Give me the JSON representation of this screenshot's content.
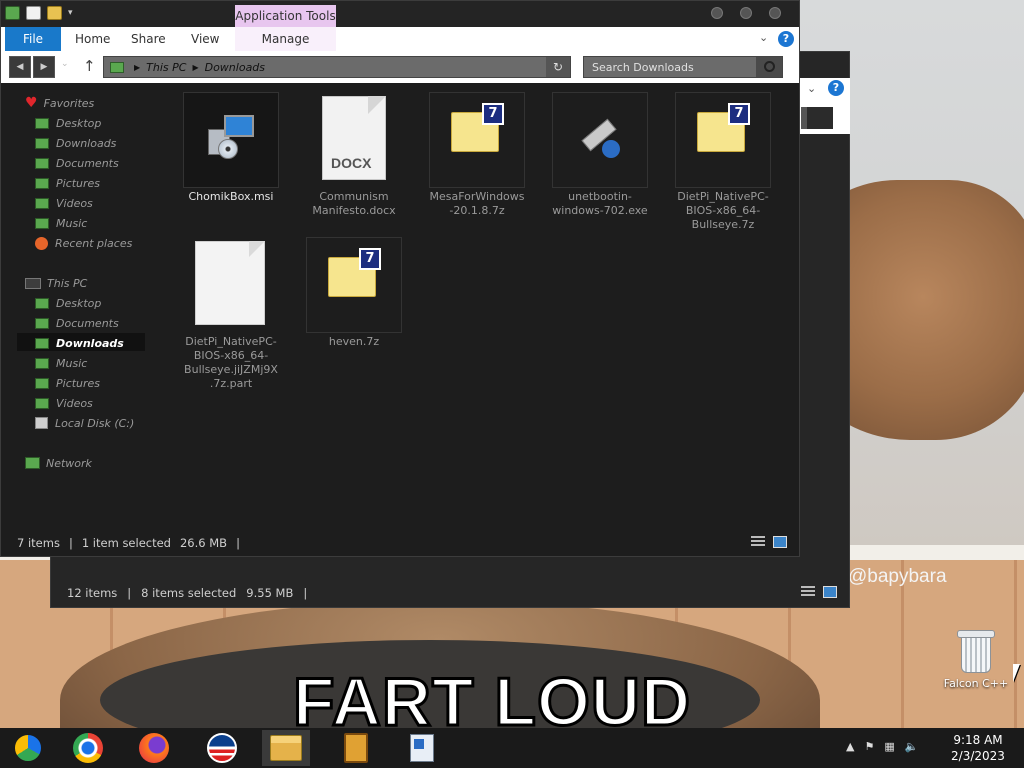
{
  "desktop": {
    "meme_text": "FART LOUD",
    "watermark": "@bapybara",
    "icon_label": "Falcon C++"
  },
  "back_window": {
    "status": {
      "count": "12 items",
      "selection": "8 items selected",
      "size": "9.55 MB"
    }
  },
  "window": {
    "context_tab": "Application Tools",
    "tabs": {
      "file": "File",
      "home": "Home",
      "share": "Share",
      "view": "View",
      "manage": "Manage"
    },
    "help_label": "?",
    "address": {
      "crumbs": [
        "This PC",
        "Downloads"
      ]
    },
    "search_placeholder": "Search Downloads",
    "navpane": {
      "favorites": "Favorites",
      "fav_items": [
        "Desktop",
        "Downloads",
        "Documents",
        "Pictures",
        "Videos",
        "Music",
        "Recent places"
      ],
      "this_pc": "This PC",
      "pc_items": [
        "Desktop",
        "Documents",
        "Downloads",
        "Music",
        "Pictures",
        "Videos",
        "Local Disk (C:)"
      ],
      "network": "Network",
      "selected": "Downloads"
    },
    "files": [
      {
        "name": "ChomikBox.msi",
        "icon": "installer-icon",
        "selected": true
      },
      {
        "name": "Communism Manifesto.docx",
        "icon": "docx-icon",
        "type_label": "DOCX"
      },
      {
        "name": "MesaForWindows-20.1.8.7z",
        "icon": "7z-archive-icon",
        "badge": "7"
      },
      {
        "name": "unetbootin-windows-702.exe",
        "icon": "usb-gear-icon"
      },
      {
        "name": "DietPi_NativePC-BIOS-x86_64-Bullseye.7z",
        "icon": "7z-archive-icon",
        "badge": "7"
      },
      {
        "name": "DietPi_NativePC-BIOS-x86_64-Bullseye.jiJZMj9X.7z.part",
        "icon": "blank-file-icon"
      },
      {
        "name": "heven.7z",
        "icon": "7z-archive-icon",
        "badge": "7"
      }
    ],
    "status": {
      "count": "7 items",
      "selection": "1 item selected",
      "size": "26.6 MB"
    }
  },
  "taskbar": {
    "apps": [
      "chromium-icon",
      "chrome-icon",
      "firefox-icon",
      "obama-logo-icon",
      "file-explorer-icon",
      "book-icon",
      "document-app-icon"
    ],
    "time": "9:18 AM",
    "date": "2/3/2023"
  },
  "colors": {
    "accent": "#1979ca",
    "context_tab": "#e8c6ef",
    "window_bg": "#1d1d1d"
  }
}
